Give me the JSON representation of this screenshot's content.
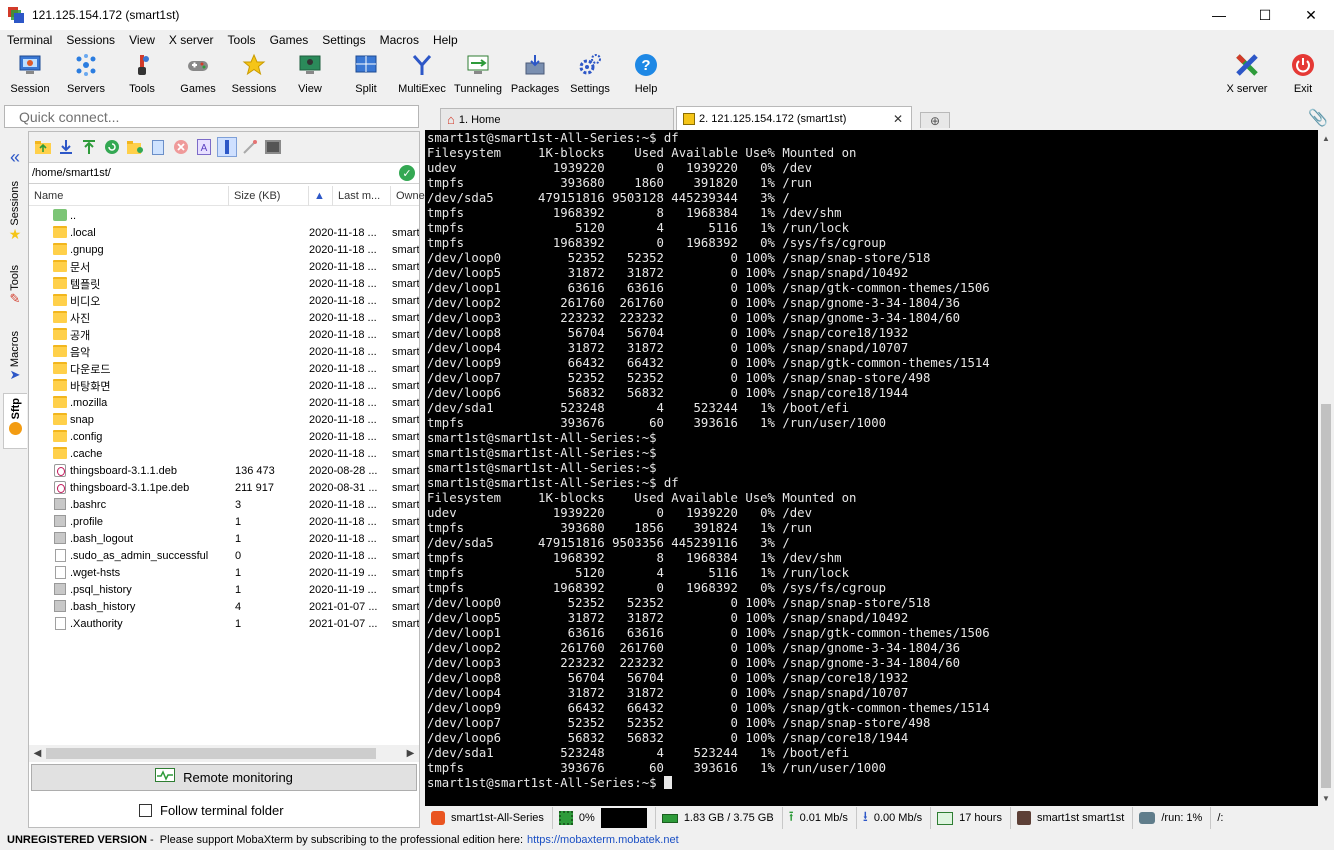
{
  "window": {
    "title": "121.125.154.172 (smart1st)",
    "minimize": "—",
    "maximize": "☐",
    "close": "✕"
  },
  "menu": [
    "Terminal",
    "Sessions",
    "View",
    "X server",
    "Tools",
    "Games",
    "Settings",
    "Macros",
    "Help"
  ],
  "toolbar": {
    "items": [
      {
        "label": "Session",
        "icon": "session-icon"
      },
      {
        "label": "Servers",
        "icon": "servers-icon"
      },
      {
        "label": "Tools",
        "icon": "tools-icon"
      },
      {
        "label": "Games",
        "icon": "games-icon"
      },
      {
        "label": "Sessions",
        "icon": "star-icon"
      },
      {
        "label": "View",
        "icon": "view-icon"
      },
      {
        "label": "Split",
        "icon": "split-icon"
      },
      {
        "label": "MultiExec",
        "icon": "multiexec-icon"
      },
      {
        "label": "Tunneling",
        "icon": "tunneling-icon"
      },
      {
        "label": "Packages",
        "icon": "packages-icon"
      },
      {
        "label": "Settings",
        "icon": "gear-icon"
      },
      {
        "label": "Help",
        "icon": "help-icon"
      }
    ],
    "xserver_label": "X server",
    "exit_label": "Exit"
  },
  "quick_connect": {
    "placeholder": "Quick connect..."
  },
  "side_tabs": [
    "Sessions",
    "Tools",
    "Macros",
    "Sftp"
  ],
  "sftp": {
    "path": "/home/smart1st/",
    "columns": {
      "name": "Name",
      "size": "Size (KB)",
      "modified": "Last m...",
      "owner": "Owne"
    },
    "files": [
      {
        "name": "..",
        "size": "",
        "date": "",
        "owner": "",
        "type": "up"
      },
      {
        "name": ".local",
        "size": "",
        "date": "2020-11-18 ...",
        "owner": "smart",
        "type": "folder"
      },
      {
        "name": ".gnupg",
        "size": "",
        "date": "2020-11-18 ...",
        "owner": "smart",
        "type": "folder"
      },
      {
        "name": "문서",
        "size": "",
        "date": "2020-11-18 ...",
        "owner": "smart",
        "type": "folder"
      },
      {
        "name": "템플릿",
        "size": "",
        "date": "2020-11-18 ...",
        "owner": "smart",
        "type": "folder"
      },
      {
        "name": "비디오",
        "size": "",
        "date": "2020-11-18 ...",
        "owner": "smart",
        "type": "folder"
      },
      {
        "name": "사진",
        "size": "",
        "date": "2020-11-18 ...",
        "owner": "smart",
        "type": "folder"
      },
      {
        "name": "공개",
        "size": "",
        "date": "2020-11-18 ...",
        "owner": "smart",
        "type": "folder"
      },
      {
        "name": "음악",
        "size": "",
        "date": "2020-11-18 ...",
        "owner": "smart",
        "type": "folder"
      },
      {
        "name": "다운로드",
        "size": "",
        "date": "2020-11-18 ...",
        "owner": "smart",
        "type": "folder"
      },
      {
        "name": "바탕화면",
        "size": "",
        "date": "2020-11-18 ...",
        "owner": "smart",
        "type": "folder"
      },
      {
        "name": ".mozilla",
        "size": "",
        "date": "2020-11-18 ...",
        "owner": "smart",
        "type": "folder"
      },
      {
        "name": "snap",
        "size": "",
        "date": "2020-11-18 ...",
        "owner": "smart",
        "type": "folder"
      },
      {
        "name": ".config",
        "size": "",
        "date": "2020-11-18 ...",
        "owner": "smart",
        "type": "folder"
      },
      {
        "name": ".cache",
        "size": "",
        "date": "2020-11-18 ...",
        "owner": "smart",
        "type": "folder"
      },
      {
        "name": "thingsboard-3.1.1.deb",
        "size": "136 473",
        "date": "2020-08-28 ...",
        "owner": "smart",
        "type": "deb"
      },
      {
        "name": "thingsboard-3.1.1pe.deb",
        "size": "211 917",
        "date": "2020-08-31 ...",
        "owner": "smart",
        "type": "deb"
      },
      {
        "name": ".bashrc",
        "size": "3",
        "date": "2020-11-18 ...",
        "owner": "smart",
        "type": "gray"
      },
      {
        "name": ".profile",
        "size": "1",
        "date": "2020-11-18 ...",
        "owner": "smart",
        "type": "gray"
      },
      {
        "name": ".bash_logout",
        "size": "1",
        "date": "2020-11-18 ...",
        "owner": "smart",
        "type": "gray"
      },
      {
        "name": ".sudo_as_admin_successful",
        "size": "0",
        "date": "2020-11-18 ...",
        "owner": "smart",
        "type": "file"
      },
      {
        "name": ".wget-hsts",
        "size": "1",
        "date": "2020-11-19 ...",
        "owner": "smart",
        "type": "file"
      },
      {
        "name": ".psql_history",
        "size": "1",
        "date": "2020-11-19 ...",
        "owner": "smart",
        "type": "gray"
      },
      {
        "name": ".bash_history",
        "size": "4",
        "date": "2021-01-07 ...",
        "owner": "smart",
        "type": "gray"
      },
      {
        "name": ".Xauthority",
        "size": "1",
        "date": "2021-01-07 ...",
        "owner": "smart",
        "type": "file"
      }
    ],
    "remote_monitoring": "Remote monitoring",
    "follow_terminal": "Follow terminal folder"
  },
  "tabs": [
    {
      "label": "1. Home",
      "active": false
    },
    {
      "label": "2. 121.125.154.172 (smart1st)",
      "active": true
    }
  ],
  "terminal": {
    "lines": [
      "smart1st@smart1st-All-Series:~$ df",
      "Filesystem     1K-blocks    Used Available Use% Mounted on",
      "udev             1939220       0   1939220   0% /dev",
      "tmpfs             393680    1860    391820   1% /run",
      "/dev/sda5      479151816 9503128 445239344   3% /",
      "tmpfs            1968392       8   1968384   1% /dev/shm",
      "tmpfs               5120       4      5116   1% /run/lock",
      "tmpfs            1968392       0   1968392   0% /sys/fs/cgroup",
      "/dev/loop0         52352   52352         0 100% /snap/snap-store/518",
      "/dev/loop5         31872   31872         0 100% /snap/snapd/10492",
      "/dev/loop1         63616   63616         0 100% /snap/gtk-common-themes/1506",
      "/dev/loop2        261760  261760         0 100% /snap/gnome-3-34-1804/36",
      "/dev/loop3        223232  223232         0 100% /snap/gnome-3-34-1804/60",
      "/dev/loop8         56704   56704         0 100% /snap/core18/1932",
      "/dev/loop4         31872   31872         0 100% /snap/snapd/10707",
      "/dev/loop9         66432   66432         0 100% /snap/gtk-common-themes/1514",
      "/dev/loop7         52352   52352         0 100% /snap/snap-store/498",
      "/dev/loop6         56832   56832         0 100% /snap/core18/1944",
      "/dev/sda1         523248       4    523244   1% /boot/efi",
      "tmpfs             393676      60    393616   1% /run/user/1000",
      "smart1st@smart1st-All-Series:~$",
      "smart1st@smart1st-All-Series:~$",
      "smart1st@smart1st-All-Series:~$",
      "smart1st@smart1st-All-Series:~$ df",
      "Filesystem     1K-blocks    Used Available Use% Mounted on",
      "udev             1939220       0   1939220   0% /dev",
      "tmpfs             393680    1856    391824   1% /run",
      "/dev/sda5      479151816 9503356 445239116   3% /",
      "tmpfs            1968392       8   1968384   1% /dev/shm",
      "tmpfs               5120       4      5116   1% /run/lock",
      "tmpfs            1968392       0   1968392   0% /sys/fs/cgroup",
      "/dev/loop0         52352   52352         0 100% /snap/snap-store/518",
      "/dev/loop5         31872   31872         0 100% /snap/snapd/10492",
      "/dev/loop1         63616   63616         0 100% /snap/gtk-common-themes/1506",
      "/dev/loop2        261760  261760         0 100% /snap/gnome-3-34-1804/36",
      "/dev/loop3        223232  223232         0 100% /snap/gnome-3-34-1804/60",
      "/dev/loop8         56704   56704         0 100% /snap/core18/1932",
      "/dev/loop4         31872   31872         0 100% /snap/snapd/10707",
      "/dev/loop9         66432   66432         0 100% /snap/gtk-common-themes/1514",
      "/dev/loop7         52352   52352         0 100% /snap/snap-store/498",
      "/dev/loop6         56832   56832         0 100% /snap/core18/1944",
      "/dev/sda1         523248       4    523244   1% /boot/efi",
      "tmpfs             393676      60    393616   1% /run/user/1000"
    ],
    "prompt": "smart1st@smart1st-All-Series:~$ "
  },
  "status": {
    "host": "smart1st-All-Series",
    "cpu": "0%",
    "memory": "1.83 GB / 3.75 GB",
    "upload": "0.01 Mb/s",
    "download": "0.00 Mb/s",
    "uptime": "17 hours",
    "user": "smart1st  smart1st",
    "run": "/run: 1%",
    "extra": "/:"
  },
  "footer": {
    "unregistered": "UNREGISTERED VERSION",
    "message": " -  Please support MobaXterm by subscribing to the professional edition here:",
    "link": "https://mobaxterm.mobatek.net"
  },
  "colors": {
    "accent": "#2456b3",
    "terminal_bg": "#000000",
    "terminal_fg": "#e8e8e8",
    "folder": "#ffd04a"
  }
}
